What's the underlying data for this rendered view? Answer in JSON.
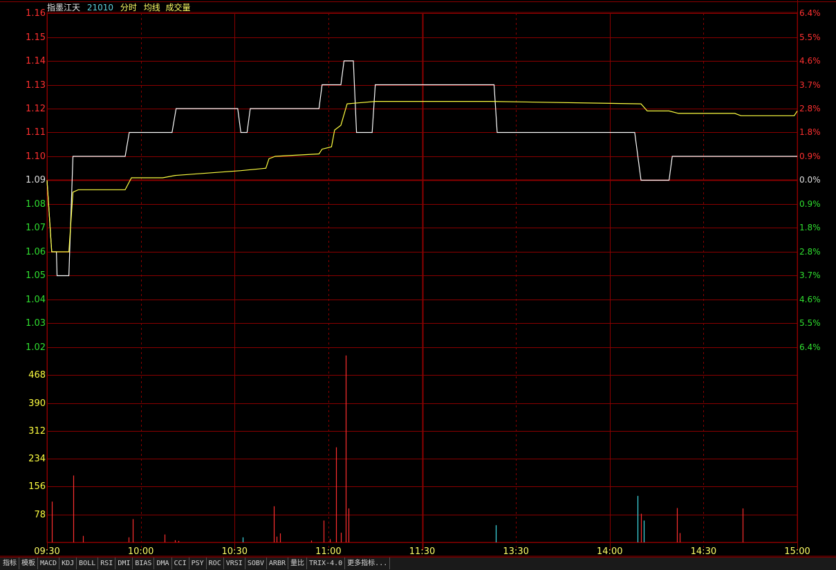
{
  "header": {
    "stock_name": "指墨江天",
    "stock_code": "21010",
    "indicators": [
      "分时",
      "均线",
      "成交量"
    ]
  },
  "colors": {
    "background": "#000000",
    "grid": "#8b0000",
    "up": "#ff3030",
    "down": "#30e030",
    "neutral": "#e0e0e0",
    "price_line": "#ffffff",
    "avg_line": "#ffff40",
    "volume_up": "#ff3030",
    "volume_down": "#40e0e8",
    "volume_axis": "#ffff40"
  },
  "bottom_tabs": [
    "指标",
    "模板",
    "MACD",
    "KDJ",
    "BOLL",
    "RSI",
    "DMI",
    "BIAS",
    "DMA",
    "CCI",
    "PSY",
    "ROC",
    "VRSI",
    "SOBV",
    "ARBR",
    "量比",
    "TRIX-4.0",
    "更多指标..."
  ],
  "chart_data": {
    "type": "line",
    "x_unit": "minutes",
    "x_ticks": [
      {
        "label": "09:30",
        "t": 0
      },
      {
        "label": "10:00",
        "t": 30
      },
      {
        "label": "10:30",
        "t": 60
      },
      {
        "label": "11:00",
        "t": 90
      },
      {
        "label": "11:30",
        "t": 120
      },
      {
        "label": "13:30",
        "t": 150
      },
      {
        "label": "14:00",
        "t": 180
      },
      {
        "label": "14:30",
        "t": 210
      },
      {
        "label": "15:00",
        "t": 240
      }
    ],
    "price_axis": {
      "ylim": [
        1.02,
        1.16
      ],
      "reference": 1.09,
      "ticks": [
        "1.16",
        "1.15",
        "1.14",
        "1.13",
        "1.12",
        "1.11",
        "1.10",
        "1.09",
        "1.08",
        "1.07",
        "1.06",
        "1.05",
        "1.04",
        "1.03",
        "1.02"
      ],
      "pct_ticks": [
        "6.4%",
        "5.5%",
        "4.6%",
        "3.7%",
        "2.8%",
        "1.8%",
        "0.9%",
        "0.0%",
        "0.9%",
        "1.8%",
        "2.8%",
        "3.7%",
        "4.6%",
        "5.5%",
        "6.4%"
      ]
    },
    "volume_axis": {
      "ylim": [
        0,
        546
      ],
      "ticks": [
        "468",
        "390",
        "312",
        "234",
        "156",
        "78"
      ]
    },
    "series": [
      {
        "key": "price",
        "points": [
          [
            0,
            1.09
          ],
          [
            1.5,
            1.06
          ],
          [
            3,
            1.06
          ],
          [
            3.2,
            1.05
          ],
          [
            7,
            1.05
          ],
          [
            8.3,
            1.1
          ],
          [
            25,
            1.1
          ],
          [
            26.3,
            1.11
          ],
          [
            40,
            1.11
          ],
          [
            41.3,
            1.12
          ],
          [
            61,
            1.12
          ],
          [
            62,
            1.11
          ],
          [
            64,
            1.11
          ],
          [
            65,
            1.12
          ],
          [
            87,
            1.12
          ],
          [
            88,
            1.13
          ],
          [
            94,
            1.13
          ],
          [
            95,
            1.14
          ],
          [
            98,
            1.14
          ],
          [
            99,
            1.11
          ],
          [
            104,
            1.11
          ],
          [
            105,
            1.13
          ],
          [
            143,
            1.13
          ],
          [
            144,
            1.11
          ],
          [
            188,
            1.11
          ],
          [
            190,
            1.09
          ],
          [
            199,
            1.09
          ],
          [
            200,
            1.1
          ],
          [
            240,
            1.1
          ]
        ]
      },
      {
        "key": "average",
        "points": [
          [
            0,
            1.09
          ],
          [
            1.5,
            1.06
          ],
          [
            7,
            1.06
          ],
          [
            8.3,
            1.085
          ],
          [
            10,
            1.086
          ],
          [
            25,
            1.086
          ],
          [
            27,
            1.091
          ],
          [
            37,
            1.091
          ],
          [
            41,
            1.092
          ],
          [
            62,
            1.094
          ],
          [
            70,
            1.095
          ],
          [
            71,
            1.099
          ],
          [
            73,
            1.1
          ],
          [
            87,
            1.101
          ],
          [
            88,
            1.103
          ],
          [
            91,
            1.104
          ],
          [
            92,
            1.111
          ],
          [
            94,
            1.113
          ],
          [
            96,
            1.122
          ],
          [
            105,
            1.123
          ],
          [
            142,
            1.123
          ],
          [
            190,
            1.122
          ],
          [
            192,
            1.119
          ],
          [
            199,
            1.119
          ],
          [
            202,
            1.118
          ],
          [
            220,
            1.118
          ],
          [
            222,
            1.117
          ],
          [
            239,
            1.117
          ],
          [
            240,
            1.119
          ]
        ]
      }
    ],
    "volume": [
      {
        "t": 1.5,
        "v": 114,
        "dir": "up"
      },
      {
        "t": 8.3,
        "v": 187,
        "dir": "up"
      },
      {
        "t": 11.5,
        "v": 18,
        "dir": "up"
      },
      {
        "t": 26,
        "v": 14,
        "dir": "up"
      },
      {
        "t": 27.5,
        "v": 65,
        "dir": "up"
      },
      {
        "t": 37.5,
        "v": 22,
        "dir": "up"
      },
      {
        "t": 41,
        "v": 6,
        "dir": "up"
      },
      {
        "t": 42,
        "v": 4,
        "dir": "up"
      },
      {
        "t": 62.5,
        "v": 14,
        "dir": "down"
      },
      {
        "t": 72.5,
        "v": 101,
        "dir": "up"
      },
      {
        "t": 73.5,
        "v": 16,
        "dir": "up"
      },
      {
        "t": 74.5,
        "v": 25,
        "dir": "up"
      },
      {
        "t": 84.5,
        "v": 5,
        "dir": "up"
      },
      {
        "t": 88.5,
        "v": 61,
        "dir": "up"
      },
      {
        "t": 90.5,
        "v": 9,
        "dir": "up"
      },
      {
        "t": 92.5,
        "v": 266,
        "dir": "up"
      },
      {
        "t": 94,
        "v": 27,
        "dir": "up"
      },
      {
        "t": 95.5,
        "v": 523,
        "dir": "up"
      },
      {
        "t": 96.5,
        "v": 95,
        "dir": "up"
      },
      {
        "t": 143.5,
        "v": 48,
        "dir": "down"
      },
      {
        "t": 189,
        "v": 130,
        "dir": "down"
      },
      {
        "t": 190,
        "v": 80,
        "dir": "up"
      },
      {
        "t": 191,
        "v": 61,
        "dir": "down"
      },
      {
        "t": 201.5,
        "v": 96,
        "dir": "up"
      },
      {
        "t": 202.5,
        "v": 26,
        "dir": "up"
      },
      {
        "t": 222.5,
        "v": 95,
        "dir": "up"
      }
    ]
  }
}
